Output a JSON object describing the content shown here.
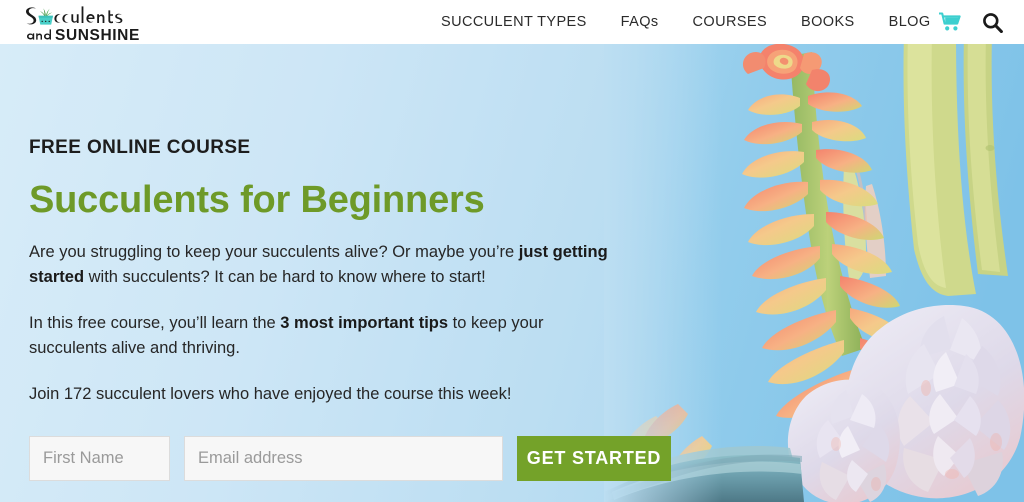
{
  "header": {
    "logo": {
      "name": "Succulents and Sunshine",
      "line1": "Succulents",
      "line2_small": "and",
      "line2_big": "SUNSHINE",
      "pot_color": "#49CFC8"
    },
    "nav": [
      {
        "label": "SUCCULENT TYPES",
        "name": "nav-succulent-types"
      },
      {
        "label": "FAQs",
        "name": "nav-faqs"
      },
      {
        "label": "COURSES",
        "name": "nav-courses"
      },
      {
        "label": "BOOKS",
        "name": "nav-books"
      },
      {
        "label": "BLOG",
        "name": "nav-blog"
      }
    ],
    "icons": {
      "cart": "cart-icon",
      "cart_color": "#3DCFCF",
      "search": "search-icon",
      "search_color": "#1a1a1a"
    }
  },
  "hero": {
    "eyebrow": "FREE ONLINE COURSE",
    "headline": "Succulents for Beginners",
    "headline_color": "#6E9A28",
    "paragraph_1": {
      "part_1": "Are you struggling to keep your succulents alive? Or maybe you’re ",
      "bold_1": "just getting started",
      "part_2": " with succulents? It can be hard to know where to start!"
    },
    "paragraph_2": {
      "part_1": "In this free course, you’ll learn the ",
      "bold_1": "3 most important tips",
      "part_2": " to keep your succulents alive and thriving."
    },
    "paragraph_3": "Join 172 succulent lovers who have enjoyed the course this week!",
    "background_color": "#BCDEF2"
  },
  "form": {
    "first_name_placeholder": "First Name",
    "first_name_value": "",
    "email_placeholder": "Email address",
    "email_value": "",
    "submit_label": "GET STARTED",
    "submit_color": "#74A229"
  },
  "photo": {
    "description": "Coral and orange sedum succulents with green stems and pale lavender echeveria rosettes in a teal pot against a blue sky",
    "sky_color": "#8FCBEA",
    "coral": "#F5896F",
    "peach": "#F8B98B",
    "yellow_green": "#C9D86A",
    "stem_green": "#7FA84B",
    "rosette": "#DCD8E8",
    "pot_teal": "#6FA5B4"
  }
}
